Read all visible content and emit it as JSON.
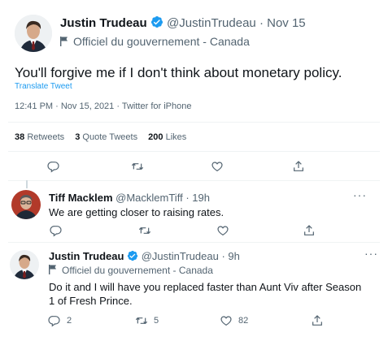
{
  "main_tweet": {
    "author_name": "Justin Trudeau",
    "handle": "@JustinTrudeau",
    "date": "Nov 15",
    "label": "Officiel du gouvernement - Canada",
    "text": "You'll forgive me if I don't think about monetary policy.",
    "translate": "Translate Tweet",
    "timestamp": "12:41 PM · Nov 15, 2021 · Twitter for iPhone",
    "stats": {
      "retweets_count": "38",
      "retweets_label": "Retweets",
      "quotes_count": "3",
      "quotes_label": "Quote Tweets",
      "likes_count": "200",
      "likes_label": "Likes"
    }
  },
  "reply_1": {
    "author_name": "Tiff Macklem",
    "handle": "@MacklemTiff",
    "time": "19h",
    "text": "We are getting closer to raising rates."
  },
  "reply_2": {
    "author_name": "Justin Trudeau",
    "handle": "@JustinTrudeau",
    "time": "9h",
    "label": "Officiel du gouvernement - Canada",
    "text": "Do it and I will have you replaced faster than Aunt Viv after Season 1 of Fresh Prince.",
    "reply_count": "2",
    "retweet_count": "5",
    "like_count": "82"
  },
  "colors": {
    "verified": "#1d9bf0",
    "link": "#1d9bf0",
    "muted": "#536471",
    "text": "#0f1419"
  }
}
